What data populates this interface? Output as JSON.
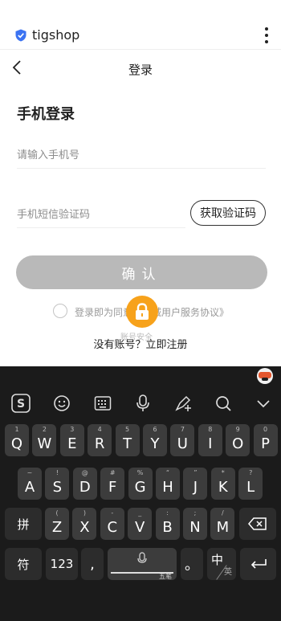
{
  "app": {
    "name": "tigshop"
  },
  "nav": {
    "title": "登录"
  },
  "form": {
    "title": "手机登录",
    "phone_placeholder": "请输入手机号",
    "code_placeholder": "手机短信验证码",
    "get_code_label": "获取验证码",
    "confirm_label": "确认",
    "agreement_text": "登录即为同意《商城用户服务协议》",
    "lock_caption": "账号安全",
    "register_text": "没有账号？立即注册"
  },
  "keyboard": {
    "row1": [
      {
        "main": "Q",
        "sub": "1"
      },
      {
        "main": "W",
        "sub": "2"
      },
      {
        "main": "E",
        "sub": "3"
      },
      {
        "main": "R",
        "sub": "4"
      },
      {
        "main": "T",
        "sub": "5"
      },
      {
        "main": "Y",
        "sub": "6"
      },
      {
        "main": "U",
        "sub": "7"
      },
      {
        "main": "I",
        "sub": "8"
      },
      {
        "main": "O",
        "sub": "9"
      },
      {
        "main": "P",
        "sub": "0"
      }
    ],
    "row2": [
      {
        "main": "A",
        "sub": "~"
      },
      {
        "main": "S",
        "sub": "!"
      },
      {
        "main": "D",
        "sub": "@"
      },
      {
        "main": "F",
        "sub": "#"
      },
      {
        "main": "G",
        "sub": "%"
      },
      {
        "main": "H",
        "sub": "“"
      },
      {
        "main": "J",
        "sub": "”"
      },
      {
        "main": "K",
        "sub": "*"
      },
      {
        "main": "L",
        "sub": "?"
      }
    ],
    "row3": [
      {
        "main": "Z",
        "sub": "("
      },
      {
        "main": "X",
        "sub": ")"
      },
      {
        "main": "C",
        "sub": "-"
      },
      {
        "main": "V",
        "sub": "_"
      },
      {
        "main": "B",
        "sub": ":"
      },
      {
        "main": "N",
        "sub": ";"
      },
      {
        "main": "M",
        "sub": "/"
      }
    ],
    "pinyin_label": "拼",
    "symbol_label": "符",
    "num_label": "123",
    "comma_label": ",",
    "space_label": "五笔",
    "period_label": "。",
    "lang_main": "中",
    "lang_sub": "英"
  }
}
